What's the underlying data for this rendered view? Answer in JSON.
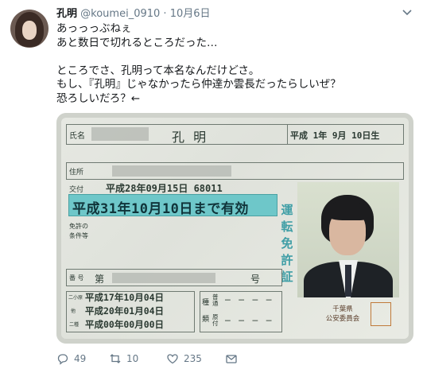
{
  "tweet": {
    "display_name": "孔明",
    "handle": "@koumei_0910",
    "separator": "·",
    "date": "10月6日",
    "lines": [
      "あっっっぶねぇ",
      "あと数日で切れるところだった…",
      "",
      "ところでさ、孔明って本名なんだけどさ。",
      "もし、『孔明』じゃなかったら仲達か雲長だったらしいぜ？",
      "恐ろしいだろ？←"
    ]
  },
  "license": {
    "name_label": "氏名",
    "name_value": "孔 明",
    "birth": "平成 1年 9月 10日生",
    "address_label": "住所",
    "issue_label": "交付",
    "issue_value": "平成28年09月15日 68011",
    "validity": "平成31年10月10日まで有効",
    "vertical_title": [
      "運",
      "転",
      "免",
      "許",
      "証"
    ],
    "conditions_label_1": "免許の",
    "conditions_label_2": "条件等",
    "number_label": "番 号",
    "number_prefix": "第",
    "number_suffix": "号",
    "history_labels": [
      "二小原",
      "他",
      "二種"
    ],
    "history_dates": [
      "平成17年10月04日",
      "平成20年01月04日",
      "平成00年00月00日"
    ],
    "category_labels": [
      "種",
      "類"
    ],
    "category_cells": [
      "普通",
      "原付"
    ],
    "issuer_lines": [
      "千葉県",
      "公安委員会"
    ],
    "stamp_text": "千葉県公安委員会印"
  },
  "actions": {
    "reply_count": "49",
    "retweet_count": "10",
    "like_count": "235"
  },
  "colors": {
    "text": "#14171a",
    "muted": "#657786",
    "license_band": "#6ec7c9"
  }
}
